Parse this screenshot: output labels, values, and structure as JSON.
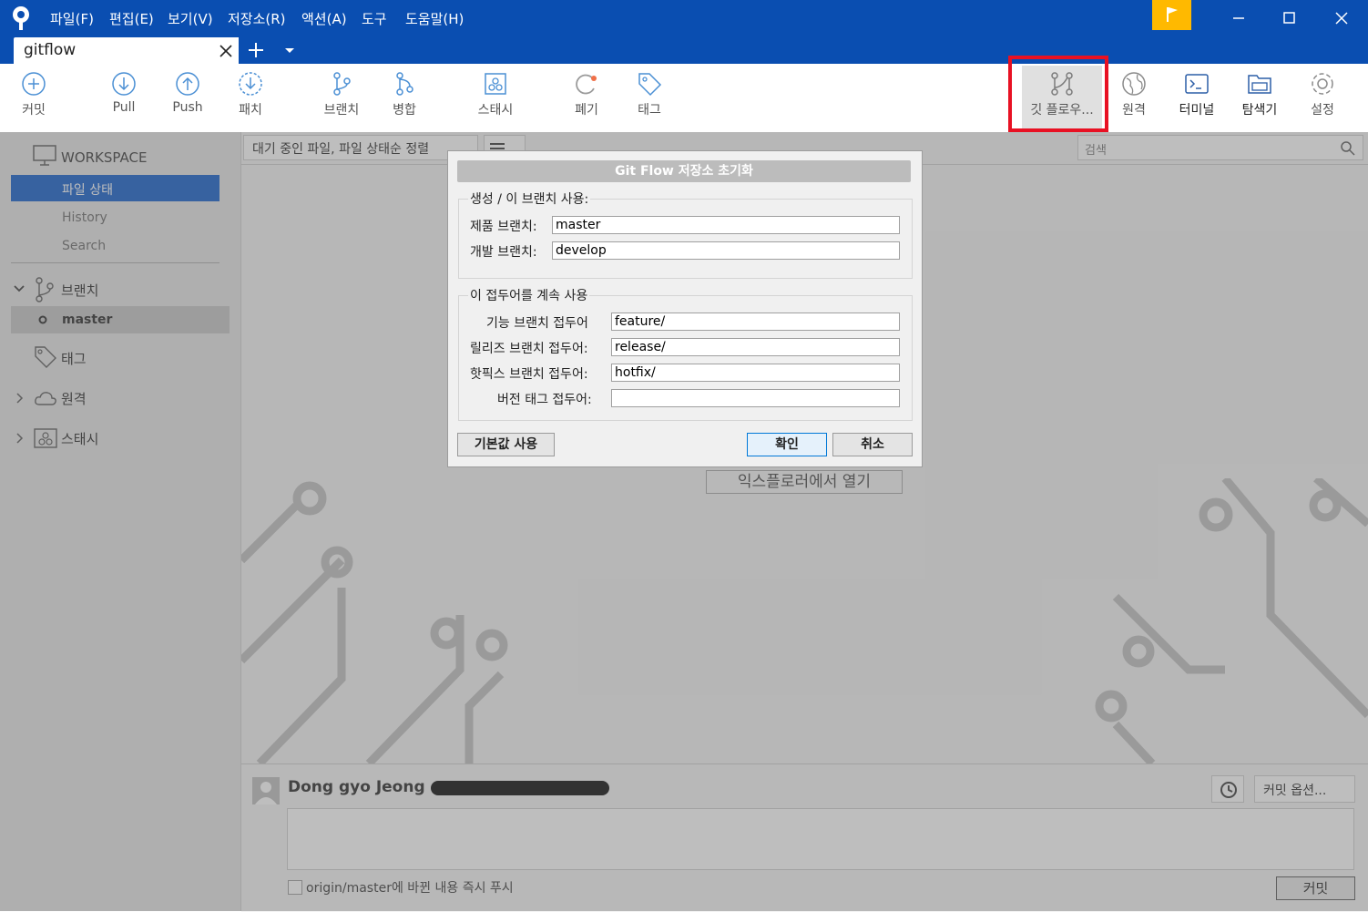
{
  "menu": [
    "파일(F)",
    "편집(E)",
    "보기(V)",
    "저장소(R)",
    "액션(A)",
    "도구",
    "도움말(H)"
  ],
  "tab": {
    "title": "gitflow"
  },
  "toolbar": {
    "commit": "커밋",
    "pull": "Pull",
    "push": "Push",
    "patch": "패치",
    "branch": "브랜치",
    "merge": "병합",
    "stash": "스태시",
    "discard": "폐기",
    "tag": "태그",
    "gitflow": "깃 플로우...",
    "remote": "원격",
    "terminal": "터미널",
    "explorer": "탐색기",
    "settings": "설정"
  },
  "sidebar": {
    "workspace": "WORKSPACE",
    "file_status": "파일 상태",
    "history": "History",
    "search": "Search",
    "branches": "브랜치",
    "master": "master",
    "tags": "태그",
    "remotes": "원격",
    "stashes": "스태시"
  },
  "main": {
    "filter": "대기 중인 파일, 파일 상태순 정렬",
    "search_placeholder": "검색",
    "open_explorer": "익스플로러에서 열기"
  },
  "dialog": {
    "title": "Git Flow 저장소 초기화",
    "group1": "생성 / 이 브랜치 사용:",
    "prod_label": "제품 브랜치:",
    "prod_value": "master",
    "dev_label": "개발 브랜치:",
    "dev_value": "develop",
    "group2": "이 접두어를 계속 사용",
    "feature_label": "기능 브랜치 접두어",
    "feature_value": "feature/",
    "release_label": "릴리즈 브랜치 접두어:",
    "release_value": "release/",
    "hotfix_label": "핫픽스 브랜치 접두어:",
    "hotfix_value": "hotfix/",
    "version_label": "버전 태그 접두어:",
    "version_value": "",
    "defaults": "기본값 사용",
    "ok": "확인",
    "cancel": "취소"
  },
  "commit": {
    "author": "Dong gyo Jeong <",
    "options": "커밋 옵션...",
    "push_label": "origin/master에 바뀐 내용 즉시 푸시",
    "button": "커밋"
  },
  "colors": {
    "titlebar": "#0a4eb1",
    "accent": "#ffb900",
    "highlight": "#e81123"
  }
}
